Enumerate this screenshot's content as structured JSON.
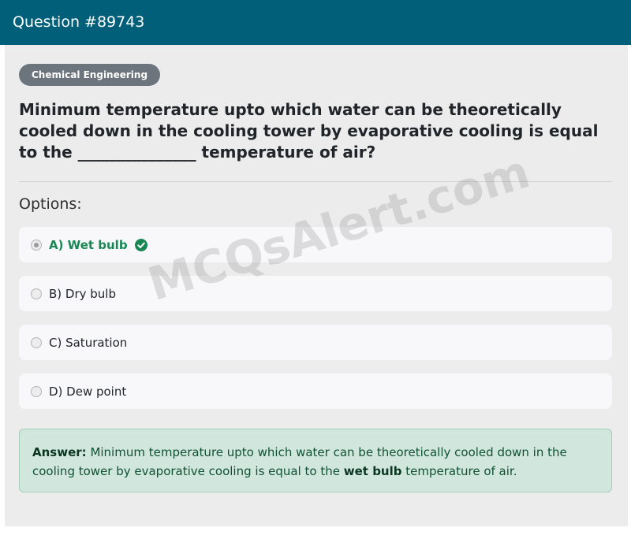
{
  "header": {
    "title": "Question #89743"
  },
  "category": "Chemical Engineering",
  "question": "Minimum temperature upto which water can be theoretically cooled down in the cooling tower by evaporative cooling is equal to the _______________ temperature of air?",
  "options_label": "Options:",
  "options": [
    {
      "label": "A) Wet bulb",
      "selected": true,
      "correct": true
    },
    {
      "label": "B) Dry bulb",
      "selected": false,
      "correct": false
    },
    {
      "label": "C) Saturation",
      "selected": false,
      "correct": false
    },
    {
      "label": "D) Dew point",
      "selected": false,
      "correct": false
    }
  ],
  "answer": {
    "prefix": "Answer:",
    "text_before": "Minimum temperature upto which water can be theoretically cooled down in the cooling tower by evaporative cooling is equal to the",
    "highlight": "wet bulb",
    "text_after": "temperature of air."
  },
  "watermark": "MCQsAlert.com",
  "colors": {
    "header": "#015f7a",
    "correct": "#198754",
    "answer_bg": "#d1e7dd",
    "badge": "#6c757d"
  }
}
